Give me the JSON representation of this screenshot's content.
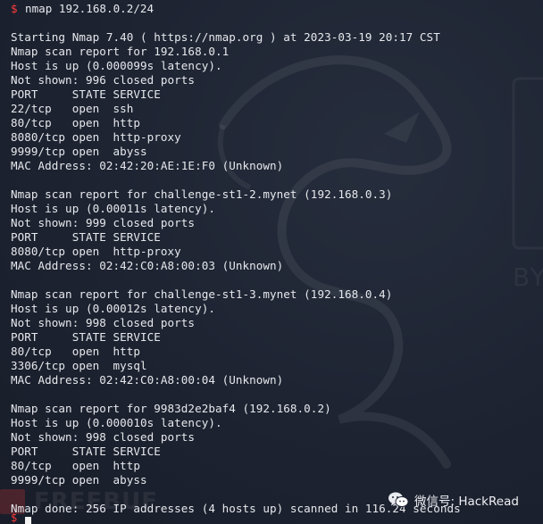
{
  "prompt": {
    "symbol": "$",
    "command": "nmap 192.168.0.2/24"
  },
  "output_lines": [
    "",
    "Starting Nmap 7.40 ( https://nmap.org ) at 2023-03-19 20:17 CST",
    "Nmap scan report for 192.168.0.1",
    "Host is up (0.000099s latency).",
    "Not shown: 996 closed ports",
    "PORT     STATE SERVICE",
    "22/tcp   open  ssh",
    "80/tcp   open  http",
    "8080/tcp open  http-proxy",
    "9999/tcp open  abyss",
    "MAC Address: 02:42:20:AE:1E:F0 (Unknown)",
    "",
    "Nmap scan report for challenge-st1-2.mynet (192.168.0.3)",
    "Host is up (0.00011s latency).",
    "Not shown: 999 closed ports",
    "PORT     STATE SERVICE",
    "8080/tcp open  http-proxy",
    "MAC Address: 02:42:C0:A8:00:03 (Unknown)",
    "",
    "Nmap scan report for challenge-st1-3.mynet (192.168.0.4)",
    "Host is up (0.00012s latency).",
    "Not shown: 998 closed ports",
    "PORT     STATE SERVICE",
    "80/tcp   open  http",
    "3306/tcp open  mysql",
    "MAC Address: 02:42:C0:A8:00:04 (Unknown)",
    "",
    "Nmap scan report for 9983d2e2baf4 (192.168.0.2)",
    "Host is up (0.000010s latency).",
    "Not shown: 998 closed ports",
    "PORT     STATE SERVICE",
    "80/tcp   open  http",
    "9999/tcp open  abyss",
    "",
    "Nmap done: 256 IP addresses (4 hosts up) scanned in 116.24 seconds"
  ],
  "bottom_prompt_symbol": "$",
  "watermark": {
    "text": "微信号: HackRead",
    "icon": "wechat-icon"
  },
  "background_watermark": "FREEBUF",
  "background_side_text": "BY",
  "colors": {
    "background": "#1d2331",
    "text": "#e6e8ec",
    "prompt": "#ff3b3b"
  }
}
